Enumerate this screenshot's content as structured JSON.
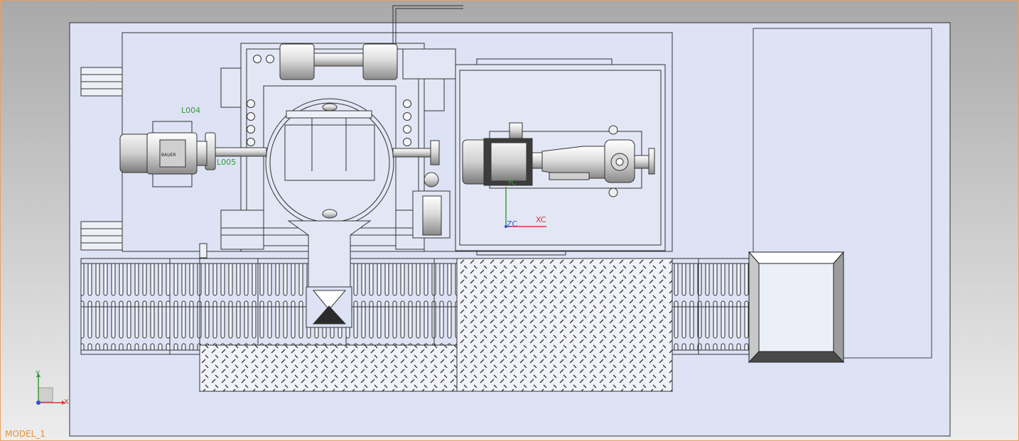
{
  "viewport": {
    "model_label": "MODEL_1",
    "frame_color": "#e8a060",
    "background_top": "#a9a9a9",
    "background_bottom": "#ededed",
    "sheet_fill": "#dde2f4"
  },
  "annotations": {
    "left_label": "L004",
    "left_label_2": "L005",
    "motor_nameplate": "BAUER"
  },
  "wcs": {
    "x_label": "XC",
    "z_label": "ZC",
    "y_label": "YC",
    "x_color": "#d63a3a",
    "y_color": "#3a9a3a",
    "z_color": "#2f4fd6"
  },
  "triad": {
    "x_label": "X",
    "y_label": "Y",
    "x_color": "#d63a3a",
    "y_color": "#3a9a3a",
    "origin_color": "#2f4fd6"
  }
}
